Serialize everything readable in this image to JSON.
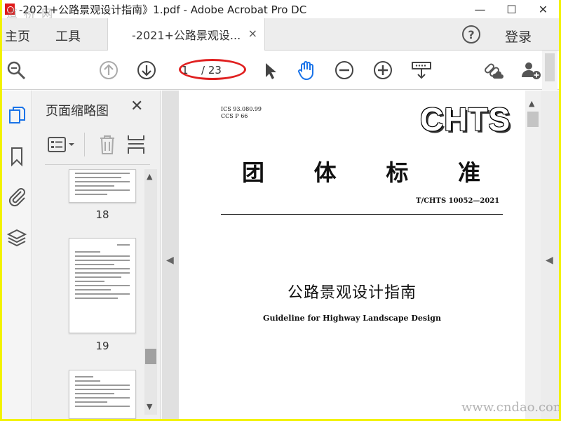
{
  "window": {
    "title": "-2021+公路景观设计指南》1.pdf - Adobe Acrobat Pro DC",
    "minimize_glyph": "—",
    "maximize_glyph": "☐",
    "close_glyph": "✕",
    "watermark_top": "道 桥 网"
  },
  "menubar": {
    "home": "主页",
    "tools": "工具",
    "doc_tab_label": "-2021+公路景观设...",
    "doc_tab_close": "×",
    "help_glyph": "?",
    "login": "登录"
  },
  "toolbar": {
    "icons": [
      "search-icon",
      "prev-page-icon",
      "next-page-icon",
      "select-cursor-icon",
      "hand-tool-icon",
      "zoom-out-icon",
      "zoom-in-icon",
      "scroll-mode-icon",
      "share-link-icon",
      "add-user-icon"
    ],
    "current_page": "1",
    "page_total": "/ 23"
  },
  "left_nav": {
    "icons": [
      "page-thumbnails-icon",
      "bookmark-icon",
      "attachment-icon",
      "layers-icon"
    ]
  },
  "thumbnail_panel": {
    "title": "页面缩略图",
    "close_glyph": "✕",
    "tools": [
      "options-menu-icon",
      "delete-icon",
      "insert-pages-icon"
    ],
    "thumbnails": [
      {
        "page_label": "18"
      },
      {
        "page_label": "19"
      },
      {
        "page_label": ""
      }
    ]
  },
  "document": {
    "ics_line1": "ICS 93.080.99",
    "ics_line2": "CCS P 66",
    "logo": "CHTS",
    "standard_type_chars": [
      "团",
      "体",
      "标",
      "准"
    ],
    "standard_number": "T/CHTS  10052—2021",
    "title_cn": "公路景观设计指南",
    "title_en": "Guideline for Highway Landscape Design"
  },
  "watermark_bottom": "www.cndao.com",
  "colors": {
    "accent_blue": "#1a73e8",
    "annotation_red": "#e02020",
    "screen_border": "#f2f200"
  }
}
